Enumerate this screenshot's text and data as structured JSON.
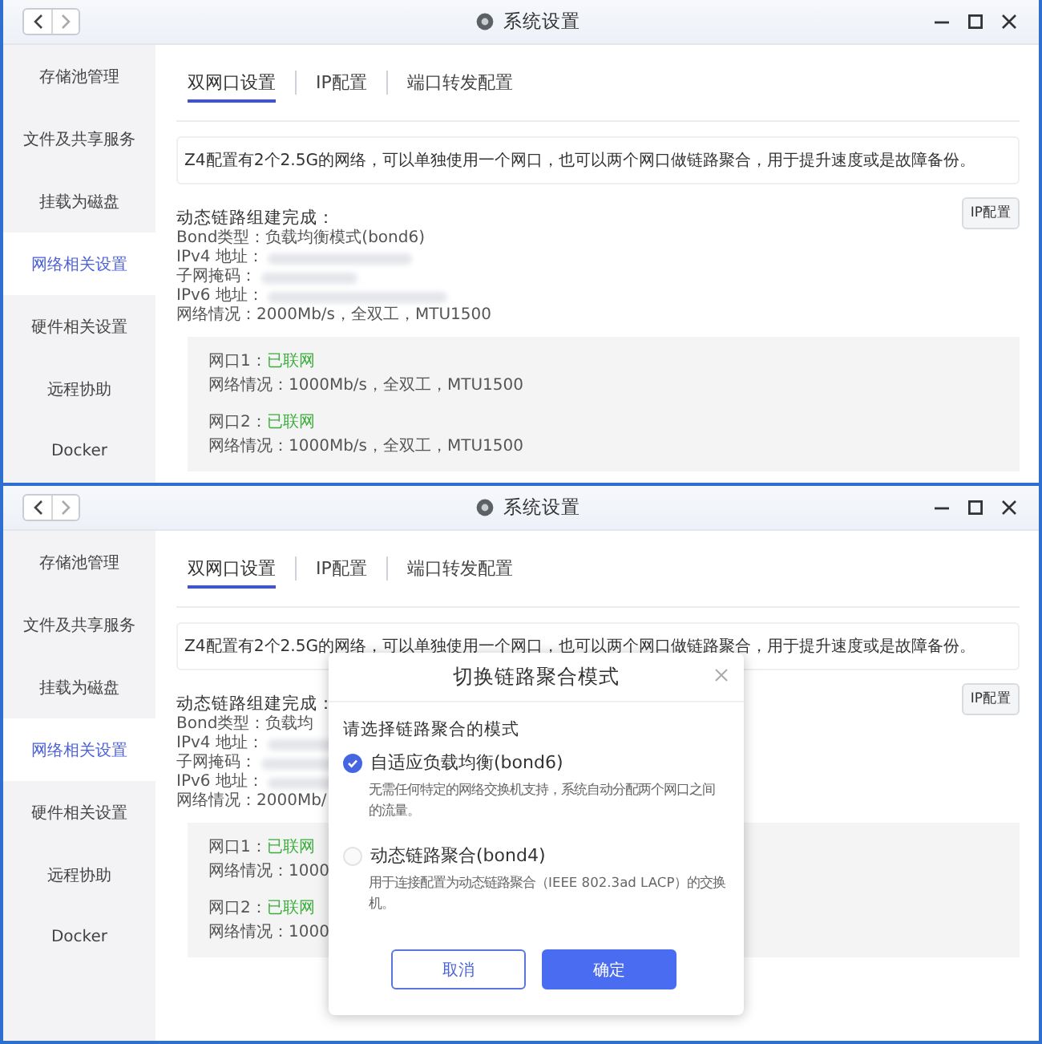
{
  "windows": [
    {
      "title": "系统设置",
      "sidebar": [
        {
          "label": "存储池管理",
          "selected": false
        },
        {
          "label": "文件及共享服务",
          "selected": false
        },
        {
          "label": "挂载为磁盘",
          "selected": false
        },
        {
          "label": "网络相关设置",
          "selected": true
        },
        {
          "label": "硬件相关设置",
          "selected": false
        },
        {
          "label": "远程协助",
          "selected": false
        },
        {
          "label": "Docker",
          "selected": false
        }
      ],
      "tabs": [
        {
          "label": "双网口设置",
          "selected": true
        },
        {
          "label": "IP配置",
          "selected": false
        },
        {
          "label": "端口转发配置",
          "selected": false
        }
      ],
      "intro": "Z4配置有2个2.5G的网络，可以单独使用一个网口，也可以两个网口做链路聚合，用于提升速度或是故障备份。",
      "status_heading": "动态链路组建完成：",
      "ip_button": "IP配置",
      "details": [
        {
          "text": "Bond类型：负载均衡模式(bond6)"
        },
        {
          "text": "IPv4 地址：",
          "redacted": true
        },
        {
          "text": "子网掩码：",
          "redacted": true
        },
        {
          "text": "IPv6 地址：",
          "redacted": true
        },
        {
          "text": "网络情况：2000Mb/s，全双工，MTU1500"
        }
      ],
      "ports": [
        {
          "name": "网口1：",
          "status": "已联网",
          "info": "网络情况：1000Mb/s，全双工，MTU1500"
        },
        {
          "name": "网口2：",
          "status": "已联网",
          "info": "网络情况：1000Mb/s，全双工，MTU1500"
        }
      ]
    },
    {
      "title": "系统设置",
      "sidebar": [
        {
          "label": "存储池管理",
          "selected": false
        },
        {
          "label": "文件及共享服务",
          "selected": false
        },
        {
          "label": "挂载为磁盘",
          "selected": false
        },
        {
          "label": "网络相关设置",
          "selected": true
        },
        {
          "label": "硬件相关设置",
          "selected": false
        },
        {
          "label": "远程协助",
          "selected": false
        },
        {
          "label": "Docker",
          "selected": false
        }
      ],
      "tabs": [
        {
          "label": "双网口设置",
          "selected": true
        },
        {
          "label": "IP配置",
          "selected": false
        },
        {
          "label": "端口转发配置",
          "selected": false
        }
      ],
      "intro": "Z4配置有2个2.5G的网络，可以单独使用一个网口，也可以两个网口做链路聚合，用于提升速度或是故障备份。",
      "status_heading": "动态链路组建完成：",
      "ip_button": "IP配置",
      "details": [
        {
          "text": "Bond类型：负载均"
        },
        {
          "text": "IPv4 地址：",
          "redacted": true
        },
        {
          "text": "子网掩码：",
          "redacted": true
        },
        {
          "text": "IPv6 地址：",
          "redacted": true
        },
        {
          "text": "网络情况：2000Mb/"
        }
      ],
      "ports": [
        {
          "name": "网口1：",
          "status": "已联网",
          "info": "网络情况：1000"
        },
        {
          "name": "网口2：",
          "status": "已联网",
          "info": "网络情况：1000"
        }
      ],
      "dialog": {
        "title": "切换链路聚合模式",
        "prompt": "请选择链路聚合的模式",
        "options": [
          {
            "label": "自适应负载均衡(bond6)",
            "description": "无需任何特定的网络交换机支持，系统自动分配两个网口之间的流量。",
            "selected": true
          },
          {
            "label": "动态链路聚合(bond4)",
            "description": "用于连接配置为动态链路聚合（IEEE 802.3ad LACP）的交换机。",
            "selected": false
          }
        ],
        "buttons": [
          {
            "label": "取消",
            "kind": "secondary"
          },
          {
            "label": "确定",
            "kind": "primary"
          }
        ]
      }
    }
  ]
}
